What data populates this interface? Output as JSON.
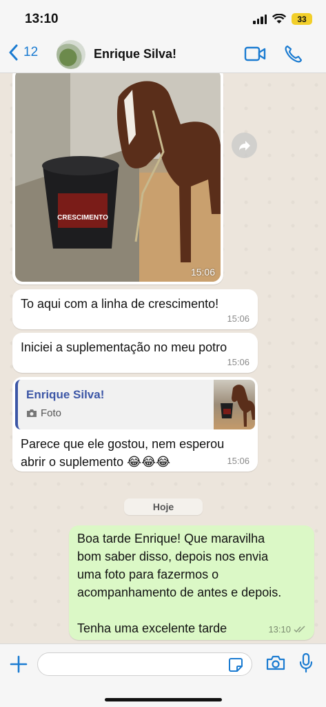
{
  "status_bar": {
    "time": "13:10",
    "battery": "33"
  },
  "header": {
    "back_count": "12",
    "contact_name": "Enrique Silva!"
  },
  "messages": {
    "photo_time": "15:06",
    "m1": {
      "text": "To aqui com a linha de crescimento!",
      "time": "15:06"
    },
    "m2": {
      "text": "Iniciei a suplementação no meu potro",
      "time": "15:06"
    },
    "m3": {
      "quote_name": "Enrique Silva!",
      "quote_type": "Foto",
      "text_line1": "Parece que ele gostou, nem esperou",
      "text_line2": "abrir o suplemento 😂😂😂",
      "time": "15:06"
    },
    "date_chip": "Hoje",
    "out": {
      "line1": "Boa tarde Enrique! Que maravilha",
      "line2": "bom saber disso, depois nos envia",
      "line3": "uma foto para fazermos o",
      "line4": "acompanhamento de antes e depois.",
      "line5": "Tenha uma excelente tarde",
      "time": "13:10"
    }
  },
  "product_label": "CRESCIMENTO",
  "composer": {
    "placeholder": ""
  },
  "colors": {
    "accent": "#1a7bd1",
    "outgoing_bubble": "#dbf8c6",
    "quote_bar": "#3c56a6"
  }
}
